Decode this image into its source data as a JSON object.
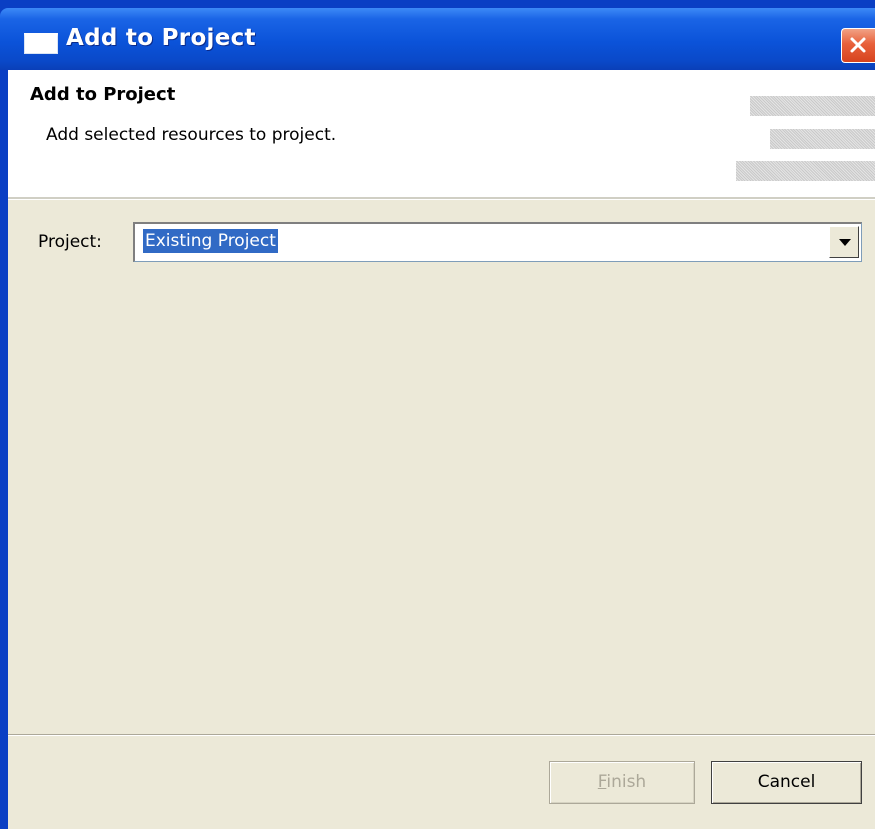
{
  "window": {
    "title": "Add to Project"
  },
  "banner": {
    "title": "Add to Project",
    "description": "Add selected resources to project."
  },
  "form": {
    "project_label": "Project:",
    "project_value": "Existing Project"
  },
  "buttons": {
    "finish_label": "Finish",
    "cancel_label": "Cancel",
    "finish_enabled": false
  },
  "colors": {
    "titlebar": "#0b53d9",
    "client_bg": "#ece9d8",
    "selection": "#316ac5",
    "close_button": "#e8613b"
  }
}
